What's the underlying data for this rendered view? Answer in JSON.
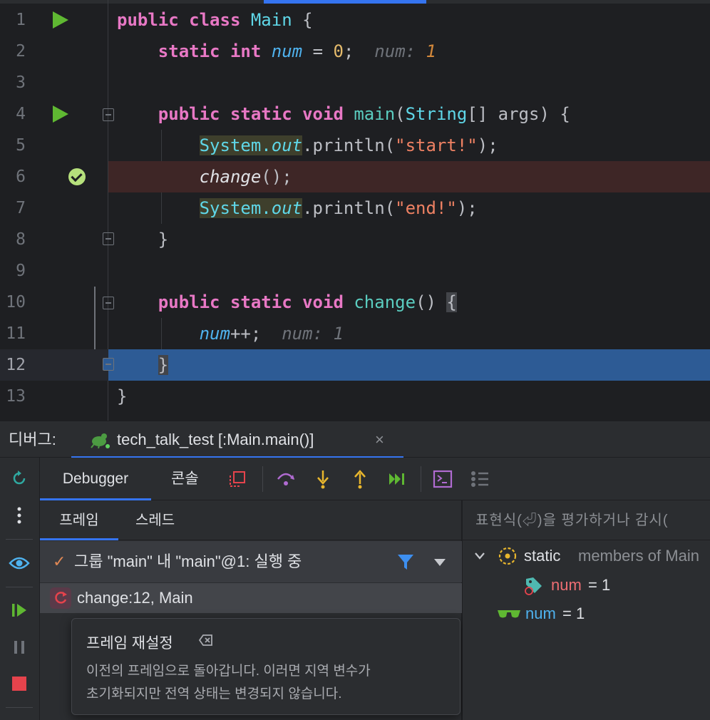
{
  "editor": {
    "lines": [
      {
        "n": "1"
      },
      {
        "n": "2"
      },
      {
        "n": "3"
      },
      {
        "n": "4"
      },
      {
        "n": "5"
      },
      {
        "n": "6"
      },
      {
        "n": "7"
      },
      {
        "n": "8"
      },
      {
        "n": "9"
      },
      {
        "n": "10"
      },
      {
        "n": "11"
      },
      {
        "n": "12"
      },
      {
        "n": "13"
      }
    ],
    "code": {
      "l1": {
        "kw1": "public",
        "kw2": "class",
        "cls": "Main",
        "rest": " {"
      },
      "l2": {
        "kw1": "static",
        "kw2": "int",
        "fld": "num",
        "eq": " = ",
        "num": "0",
        "semi": ";",
        "inlay_label": "num: ",
        "inlay_value": "1"
      },
      "l4": {
        "kw1": "public",
        "kw2": "static",
        "kw3": "void",
        "fn": "main",
        "p1": "(",
        "cls": "String",
        "p2": "[] args) {"
      },
      "l5": {
        "sys": "System",
        "dot": ".",
        "fld": "out",
        "call": ".println(",
        "str": "\"start!\"",
        "end": ");"
      },
      "l6": {
        "call": "change",
        "end": "();"
      },
      "l7": {
        "sys": "System",
        "dot": ".",
        "fld": "out",
        "call": ".println(",
        "str": "\"end!\"",
        "end": ");"
      },
      "l8": {
        "text": "}"
      },
      "l10": {
        "kw1": "public",
        "kw2": "static",
        "kw3": "void",
        "fn": "change",
        "p": "() ",
        "brace": "{"
      },
      "l11": {
        "fld": "num",
        "op": "++;",
        "inlay": "num: 1"
      },
      "l12": {
        "brace": "}"
      },
      "l13": {
        "text": "}"
      }
    }
  },
  "debug_header": {
    "title": "디버그:",
    "session_label": "tech_talk_test [:Main.main()]",
    "close": "×"
  },
  "debugger_tabs": {
    "debugger": "Debugger",
    "console": "콘솔"
  },
  "frames": {
    "tab_frames": "프레임",
    "tab_threads": "스레드",
    "thread_check": "✓",
    "thread_label": "그룹 \"main\" 내 \"main\"@1: 실행 중",
    "frame_label": "change:12, Main"
  },
  "tooltip": {
    "title": "프레임 재설정",
    "body_line1": "이전의 프레임으로 돌아갑니다. 이러면 지역 변수가",
    "body_line2": "초기화되지만 전역 상태는 변경되지 않습니다."
  },
  "variables": {
    "eval_placeholder": "표현식(⏎)을 평가하거나 감시(",
    "static_label": "static",
    "static_rest": " members of Main",
    "field_name": "num",
    "field_value": " = 1",
    "watch_name": "num",
    "watch_value": " = 1"
  },
  "colors": {
    "accent": "#3574f0",
    "run_green": "#5fb832",
    "stop_red": "#e5434c",
    "exec_line": "#2d5b95",
    "breakpoint_line": "#3e2626"
  }
}
